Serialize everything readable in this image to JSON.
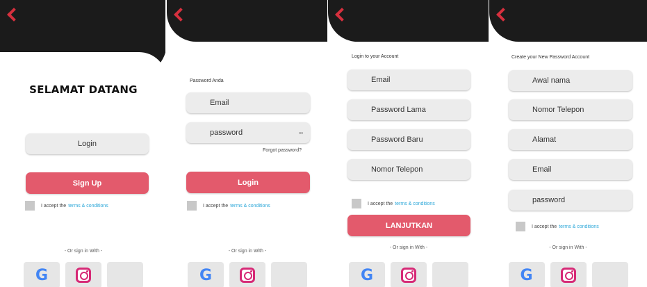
{
  "screen1": {
    "title": "SELAMAT DATANG",
    "login_label": "Login",
    "signup_label": "Sign Up",
    "terms_text": "I accept the",
    "terms_link": "terms & conditions",
    "or_text": "- Or sign in With -"
  },
  "screen2": {
    "heading": "Password Anda",
    "email_placeholder": "Email",
    "password_placeholder": "password",
    "toggle_icon": "eye-icon",
    "toggle_glyph": "••",
    "forgot": "Forgot password?",
    "login_label": "Login",
    "terms_text": "I accept the",
    "terms_link": "terms & conditions",
    "or_text": "- Or sign in With -"
  },
  "screen3": {
    "heading": "Login to your Account",
    "fields": [
      "Email",
      "Password Lama",
      "Password Baru",
      "Nomor Telepon"
    ],
    "terms_text": "I accept the",
    "terms_link": "terms & conditions",
    "button_label": "LANJUTKAN",
    "or_text": "- Or sign in With -"
  },
  "screen4": {
    "heading": "Create your New Password Account",
    "fields": [
      "Awal nama",
      "Nomor Telepon",
      "Alamat",
      "Email",
      "password"
    ],
    "terms_text": "I accept the",
    "terms_link": "terms & conditions",
    "or_text": "- Or sign in With -"
  },
  "social": {
    "google_glyph": "G",
    "apple_glyph": ""
  },
  "colors": {
    "accent": "#e35a6c",
    "header": "#1b1b1b",
    "back_arrow": "#d6303e",
    "link": "#2aa6d8"
  }
}
